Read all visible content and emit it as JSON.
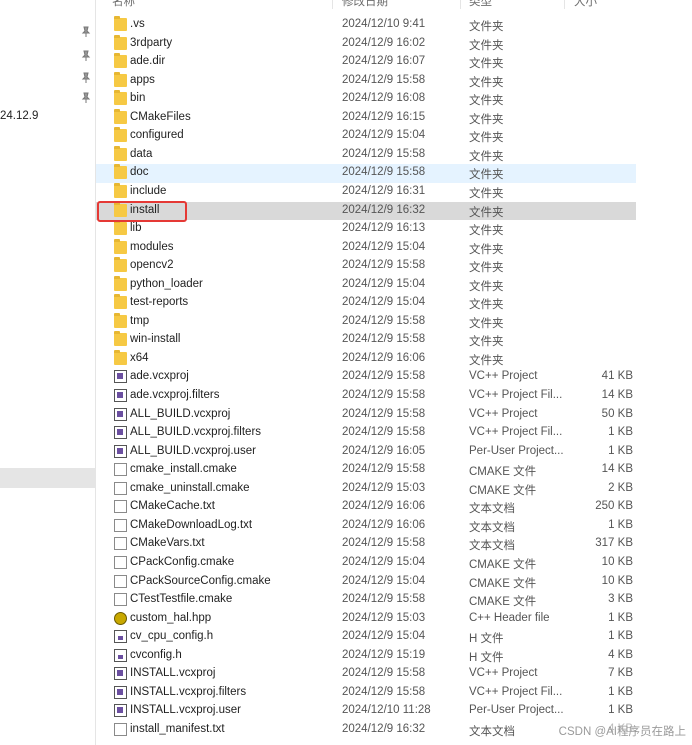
{
  "header": {
    "name": "名称",
    "date": "修改日期",
    "type": "类型",
    "size": "大小"
  },
  "nav": {
    "label": "24.12.9"
  },
  "files": [
    {
      "name": ".vs",
      "date": "2024/12/10 9:41",
      "type": "文件夹",
      "size": "",
      "icon": "folder-icon"
    },
    {
      "name": "3rdparty",
      "date": "2024/12/9 16:02",
      "type": "文件夹",
      "size": "",
      "icon": "folder-icon"
    },
    {
      "name": "ade.dir",
      "date": "2024/12/9 16:07",
      "type": "文件夹",
      "size": "",
      "icon": "folder-icon"
    },
    {
      "name": "apps",
      "date": "2024/12/9 15:58",
      "type": "文件夹",
      "size": "",
      "icon": "folder-icon"
    },
    {
      "name": "bin",
      "date": "2024/12/9 16:08",
      "type": "文件夹",
      "size": "",
      "icon": "folder-icon"
    },
    {
      "name": "CMakeFiles",
      "date": "2024/12/9 16:15",
      "type": "文件夹",
      "size": "",
      "icon": "folder-icon"
    },
    {
      "name": "configured",
      "date": "2024/12/9 15:04",
      "type": "文件夹",
      "size": "",
      "icon": "folder-icon"
    },
    {
      "name": "data",
      "date": "2024/12/9 15:58",
      "type": "文件夹",
      "size": "",
      "icon": "folder-icon"
    },
    {
      "name": "doc",
      "date": "2024/12/9 15:58",
      "type": "文件夹",
      "size": "",
      "icon": "folder-icon"
    },
    {
      "name": "include",
      "date": "2024/12/9 16:31",
      "type": "文件夹",
      "size": "",
      "icon": "folder-icon"
    },
    {
      "name": "install",
      "date": "2024/12/9 16:32",
      "type": "文件夹",
      "size": "",
      "icon": "folder-icon"
    },
    {
      "name": "lib",
      "date": "2024/12/9 16:13",
      "type": "文件夹",
      "size": "",
      "icon": "folder-icon"
    },
    {
      "name": "modules",
      "date": "2024/12/9 15:04",
      "type": "文件夹",
      "size": "",
      "icon": "folder-icon"
    },
    {
      "name": "opencv2",
      "date": "2024/12/9 15:58",
      "type": "文件夹",
      "size": "",
      "icon": "folder-icon"
    },
    {
      "name": "python_loader",
      "date": "2024/12/9 15:04",
      "type": "文件夹",
      "size": "",
      "icon": "folder-icon"
    },
    {
      "name": "test-reports",
      "date": "2024/12/9 15:04",
      "type": "文件夹",
      "size": "",
      "icon": "folder-icon"
    },
    {
      "name": "tmp",
      "date": "2024/12/9 15:58",
      "type": "文件夹",
      "size": "",
      "icon": "folder-icon"
    },
    {
      "name": "win-install",
      "date": "2024/12/9 15:58",
      "type": "文件夹",
      "size": "",
      "icon": "folder-icon"
    },
    {
      "name": "x64",
      "date": "2024/12/9 16:06",
      "type": "文件夹",
      "size": "",
      "icon": "folder-icon"
    },
    {
      "name": "ade.vcxproj",
      "date": "2024/12/9 15:58",
      "type": "VC++ Project",
      "size": "41 KB",
      "icon": "vcxproj-icon"
    },
    {
      "name": "ade.vcxproj.filters",
      "date": "2024/12/9 15:58",
      "type": "VC++ Project Fil...",
      "size": "14 KB",
      "icon": "vcxproj-filters-icon"
    },
    {
      "name": "ALL_BUILD.vcxproj",
      "date": "2024/12/9 15:58",
      "type": "VC++ Project",
      "size": "50 KB",
      "icon": "vcxproj-icon"
    },
    {
      "name": "ALL_BUILD.vcxproj.filters",
      "date": "2024/12/9 15:58",
      "type": "VC++ Project Fil...",
      "size": "1 KB",
      "icon": "vcxproj-filters-icon"
    },
    {
      "name": "ALL_BUILD.vcxproj.user",
      "date": "2024/12/9 16:05",
      "type": "Per-User Project...",
      "size": "1 KB",
      "icon": "vcxproj-user-icon"
    },
    {
      "name": "cmake_install.cmake",
      "date": "2024/12/9 15:58",
      "type": "CMAKE 文件",
      "size": "14 KB",
      "icon": "file-icon"
    },
    {
      "name": "cmake_uninstall.cmake",
      "date": "2024/12/9 15:03",
      "type": "CMAKE 文件",
      "size": "2 KB",
      "icon": "file-icon"
    },
    {
      "name": "CMakeCache.txt",
      "date": "2024/12/9 16:06",
      "type": "文本文档",
      "size": "250 KB",
      "icon": "file-icon"
    },
    {
      "name": "CMakeDownloadLog.txt",
      "date": "2024/12/9 16:06",
      "type": "文本文档",
      "size": "1 KB",
      "icon": "file-icon"
    },
    {
      "name": "CMakeVars.txt",
      "date": "2024/12/9 15:58",
      "type": "文本文档",
      "size": "317 KB",
      "icon": "file-icon"
    },
    {
      "name": "CPackConfig.cmake",
      "date": "2024/12/9 15:04",
      "type": "CMAKE 文件",
      "size": "10 KB",
      "icon": "file-icon"
    },
    {
      "name": "CPackSourceConfig.cmake",
      "date": "2024/12/9 15:04",
      "type": "CMAKE 文件",
      "size": "10 KB",
      "icon": "file-icon"
    },
    {
      "name": "CTestTestfile.cmake",
      "date": "2024/12/9 15:58",
      "type": "CMAKE 文件",
      "size": "3 KB",
      "icon": "file-icon"
    },
    {
      "name": "custom_hal.hpp",
      "date": "2024/12/9 15:03",
      "type": "C++ Header file",
      "size": "1 KB",
      "icon": "hpp-icon"
    },
    {
      "name": "cv_cpu_config.h",
      "date": "2024/12/9 15:04",
      "type": "H 文件",
      "size": "1 KB",
      "icon": "h-file-icon"
    },
    {
      "name": "cvconfig.h",
      "date": "2024/12/9 15:19",
      "type": "H 文件",
      "size": "4 KB",
      "icon": "h-file-icon"
    },
    {
      "name": "INSTALL.vcxproj",
      "date": "2024/12/9 15:58",
      "type": "VC++ Project",
      "size": "7 KB",
      "icon": "vcxproj-icon"
    },
    {
      "name": "INSTALL.vcxproj.filters",
      "date": "2024/12/9 15:58",
      "type": "VC++ Project Fil...",
      "size": "1 KB",
      "icon": "vcxproj-filters-icon"
    },
    {
      "name": "INSTALL.vcxproj.user",
      "date": "2024/12/10 11:28",
      "type": "Per-User Project...",
      "size": "1 KB",
      "icon": "vcxproj-user-icon"
    },
    {
      "name": "install_manifest.txt",
      "date": "2024/12/9 16:32",
      "type": "文本文档",
      "size": "4 KB",
      "icon": "file-icon"
    }
  ],
  "watermark": "CSDN @AI程序员在路上",
  "colors": {
    "hover_row": "#e5f3ff",
    "selected_row": "#d9d9d9",
    "highlight_box": "#e53935",
    "folder": "#f6c944"
  }
}
